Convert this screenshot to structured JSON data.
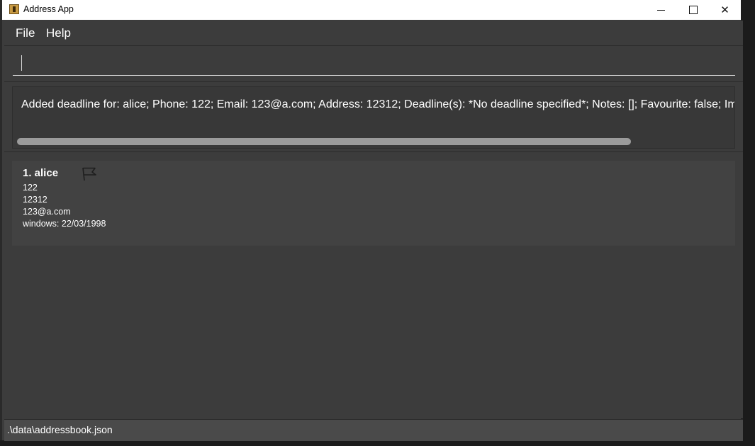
{
  "window": {
    "title": "Address App",
    "icon": "address-book-icon"
  },
  "controls": {
    "minimize": "minimize-icon",
    "maximize": "maximize-icon",
    "close_symbol": "✕"
  },
  "menu": {
    "file": "File",
    "help": "Help"
  },
  "command": {
    "value": "",
    "placeholder": ""
  },
  "result": {
    "text": "Added deadline for: alice; Phone: 122; Email: 123@a.com; Address: 12312; Deadline(s): *No deadline specified*; Notes: []; Favourite: false; Im"
  },
  "persons": [
    {
      "index": "1.",
      "name": "alice",
      "name_display": "1.  alice",
      "flag_icon": "flag-icon",
      "phone": "122",
      "address": "12312",
      "email": "123@a.com",
      "deadline": "windows: 22/03/1998"
    }
  ],
  "status": {
    "path": ".\\data\\addressbook.json"
  },
  "colors": {
    "background": "#3c3c3c",
    "card": "#424242",
    "text": "#ffffff"
  }
}
